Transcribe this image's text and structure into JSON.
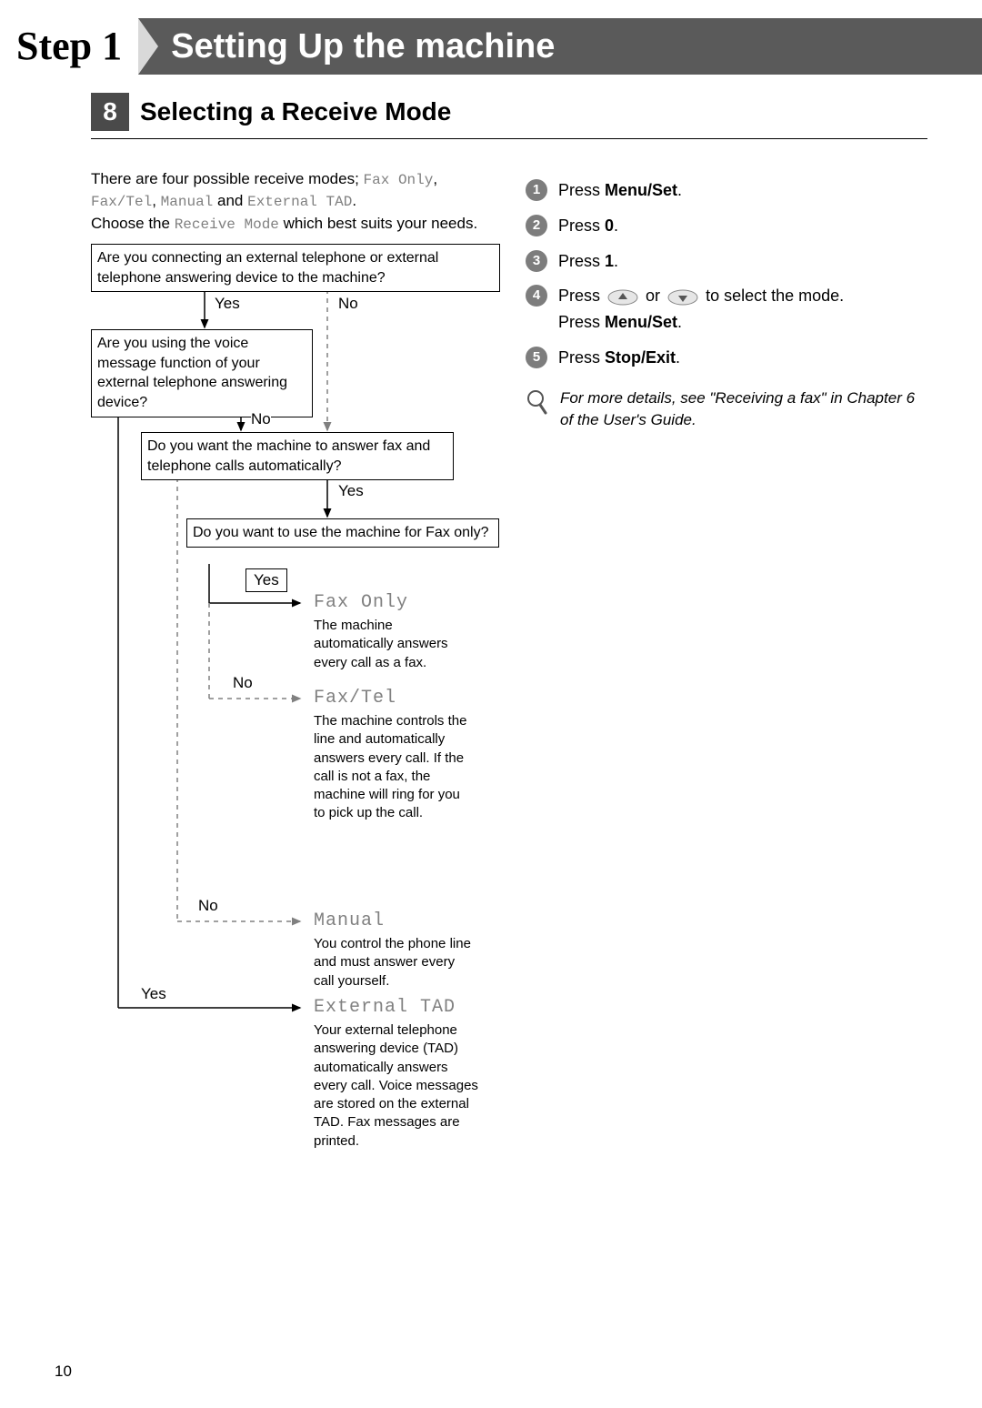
{
  "header": {
    "step_label": "Step 1",
    "title": "Setting Up the machine"
  },
  "section": {
    "number": "8",
    "title": "Selecting a Receive Mode"
  },
  "intro": {
    "line1": "There are four possible receive modes; ",
    "mode1": "Fax Only",
    "sep1": ", ",
    "mode2": "Fax/Tel",
    "sep2": ", ",
    "mode3": "Manual",
    "and": " and ",
    "mode4": "External TAD",
    "period": ".",
    "line2a": "Choose the ",
    "receive_mode": "Receive Mode",
    "line2b": " which best suits your needs."
  },
  "flow": {
    "q1": "Are you connecting an external telephone or external telephone answering device to the machine?",
    "q2": "Are you using the voice message function of your external telephone answering device?",
    "q3": "Do you want the machine to answer fax and telephone calls automatically?",
    "q4": "Do you want to use the machine for Fax only?",
    "yes": "Yes",
    "no": "No",
    "modes": {
      "fax_only": {
        "name": "Fax Only",
        "desc": "The machine automatically answers every call as a fax."
      },
      "fax_tel": {
        "name": "Fax/Tel",
        "desc": "The machine controls the line and automatically answers every call. If the call is not a fax, the machine will ring for you to pick up the call."
      },
      "manual": {
        "name": "Manual",
        "desc": "You control the phone line and must answer every call yourself."
      },
      "external_tad": {
        "name": "External TAD",
        "desc": "Your external telephone answering device (TAD) automatically answers every call. Voice messages are stored on the external TAD. Fax messages are printed."
      }
    }
  },
  "steps": {
    "s1a": "Press ",
    "s1b": "Menu/Set",
    "s1c": ".",
    "s2a": "Press ",
    "s2b": "0",
    "s2c": ".",
    "s3a": "Press ",
    "s3b": "1",
    "s3c": ".",
    "s4a": "Press ",
    "s4mid": " or ",
    "s4b": " to select the mode.",
    "s4c": "Press ",
    "s4d": "Menu/Set",
    "s4e": ".",
    "s5a": "Press ",
    "s5b": "Stop/Exit",
    "s5c": "."
  },
  "note": "For more details, see \"Receiving a fax\" in Chapter 6 of the User's Guide.",
  "page_number": "10"
}
